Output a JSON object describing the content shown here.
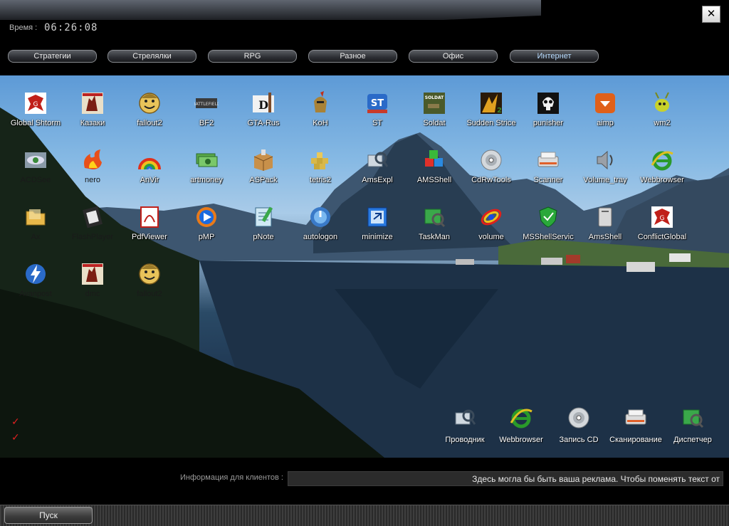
{
  "header": {
    "time_label": "Время :",
    "time_value": "06:26:08",
    "close_glyph": "✕"
  },
  "categories": [
    {
      "label": "Стратегии",
      "active": false
    },
    {
      "label": "Стрелялки",
      "active": false
    },
    {
      "label": "RPG",
      "active": false
    },
    {
      "label": "Разное",
      "active": false
    },
    {
      "label": "Офис",
      "active": false
    },
    {
      "label": "Интернет",
      "active": true
    }
  ],
  "desktop_icons": [
    {
      "label": "Global Shtorm",
      "icon": "global-shtorm-icon"
    },
    {
      "label": "Казаки",
      "icon": "kazaki-icon"
    },
    {
      "label": "fallout2",
      "icon": "fallout-vault-boy-icon"
    },
    {
      "label": "BF2",
      "icon": "battlefield-icon"
    },
    {
      "label": "GTA-Rus",
      "icon": "gta-icon"
    },
    {
      "label": "KoH",
      "icon": "knight-helmet-icon"
    },
    {
      "label": "ST",
      "icon": "st-logo-icon"
    },
    {
      "label": "Soldat",
      "icon": "soldat-icon"
    },
    {
      "label": "Sudden Strice",
      "icon": "sudden-strike-icon"
    },
    {
      "label": "punisher",
      "icon": "skull-icon"
    },
    {
      "label": "aimp",
      "icon": "aimp-icon"
    },
    {
      "label": "wm2",
      "icon": "bug-icon"
    },
    {
      "label": "ACDSee",
      "icon": "eye-icon"
    },
    {
      "label": "nero",
      "icon": "nero-flame-icon"
    },
    {
      "label": "AnVir",
      "icon": "rainbow-icon"
    },
    {
      "label": "artmoney",
      "icon": "money-icon"
    },
    {
      "label": "ASPack",
      "icon": "package-icon"
    },
    {
      "label": "tetris2",
      "icon": "tetris-icon"
    },
    {
      "label": "AmsExpl",
      "icon": "explorer-icon"
    },
    {
      "label": "AMSShell",
      "icon": "cubes-icon"
    },
    {
      "label": "CdRwTools",
      "icon": "cd-icon"
    },
    {
      "label": "Scanner",
      "icon": "scanner-icon"
    },
    {
      "label": "Volume_tray",
      "icon": "speaker-icon"
    },
    {
      "label": "Webbrowser",
      "icon": "ie-icon"
    },
    {
      "label": "Ax",
      "icon": "folder-icon"
    },
    {
      "label": "FlashPlayer",
      "icon": "film-icon"
    },
    {
      "label": "PdfViewer",
      "icon": "pdf-icon"
    },
    {
      "label": "pMP",
      "icon": "media-player-icon"
    },
    {
      "label": "pNote",
      "icon": "notepad-icon"
    },
    {
      "label": "autologon",
      "icon": "power-icon"
    },
    {
      "label": "minimize",
      "icon": "minimize-window-icon"
    },
    {
      "label": "TaskMan",
      "icon": "task-manager-icon"
    },
    {
      "label": "volume",
      "icon": "volume-ring-icon"
    },
    {
      "label": "MSShellServic",
      "icon": "shield-icon"
    },
    {
      "label": "AmsShell",
      "icon": "shell-box-icon"
    },
    {
      "label": "ConflictGlobal",
      "icon": "conflict-global-icon"
    },
    {
      "label": "Avanpost",
      "icon": "lightning-icon"
    },
    {
      "label": "dmc",
      "icon": "dmc-icon"
    },
    {
      "label": "fallout2",
      "icon": "fallout-vault-boy-icon"
    }
  ],
  "quick_launch": [
    {
      "label": "Проводник",
      "icon": "explorer-icon"
    },
    {
      "label": "Webbrowser",
      "icon": "ie-icon"
    },
    {
      "label": "Запись CD",
      "icon": "cd-icon"
    },
    {
      "label": "Сканирование",
      "icon": "scanner-icon"
    },
    {
      "label": "Диспетчер",
      "icon": "task-manager-icon"
    }
  ],
  "info": {
    "label": "Информация для клиентов :",
    "text": "Здесь могла бы быть ваша реклама. Чтобы поменять текст от"
  },
  "taskbar": {
    "start_label": "Пуск"
  },
  "colors": {
    "accent_tab": "#b8dcff",
    "check": "#e02020",
    "sky": "#86b9e4"
  }
}
